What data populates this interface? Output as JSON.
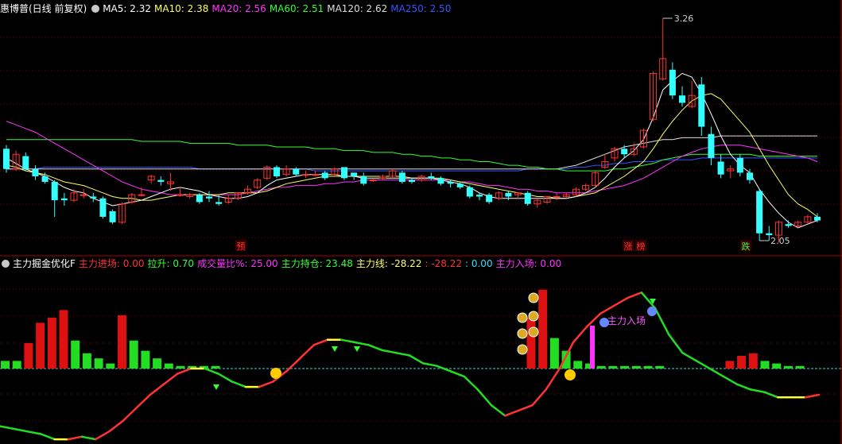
{
  "main_header": {
    "stock_title": "惠博普(日线 前复权)",
    "mas": [
      {
        "label": "MA5: 2.32",
        "color": "#ffffff"
      },
      {
        "label": "MA10: 2.38",
        "color": "#ffff66"
      },
      {
        "label": "MA20: 2.56",
        "color": "#ff33ff"
      },
      {
        "label": "MA60: 2.51",
        "color": "#33ff33"
      },
      {
        "label": "MA120: 2.62",
        "color": "#dddddd"
      },
      {
        "label": "MA250: 2.50",
        "color": "#3355ff"
      }
    ]
  },
  "price_labels": {
    "high": "3.26",
    "low": "2.05"
  },
  "markers": [
    {
      "text": "预",
      "color": "#ff3333"
    },
    {
      "text": "涨",
      "color": "#ff3333"
    },
    {
      "text": "榜",
      "color": "#ff3333"
    },
    {
      "text": "跌",
      "color": "#33ff33"
    }
  ],
  "indicator_header": {
    "title": "主力掘金优化F",
    "items": [
      {
        "label": "主力进场: 0.00",
        "color": "#ff3333"
      },
      {
        "label": "拉升: 0.70",
        "color": "#33ff33"
      },
      {
        "label": "成交量比%: 25.00",
        "color": "#ff33ff"
      },
      {
        "label": "主力持仓: 23.48",
        "color": "#33ff33"
      },
      {
        "label": "主力线: -28.22",
        "color": "#ffff66"
      },
      {
        "label": ": -28.22",
        "color": "#ff3333"
      },
      {
        "label": ": 0.00",
        "color": "#33ddff"
      },
      {
        "label": "主力入场: 0.00",
        "color": "#ff33ff"
      }
    ]
  },
  "annotation": {
    "zhuli_ruchang": "主力入场"
  },
  "colors": {
    "up": "#ff3333",
    "down": "#33ffff",
    "grid": "#7a0000",
    "bar_red": "#dd1111",
    "bar_green": "#22dd22"
  },
  "candles": [
    [
      2.55,
      2.44,
      2.57,
      2.42
    ],
    [
      2.44,
      2.52,
      2.54,
      2.43
    ],
    [
      2.51,
      2.44,
      2.53,
      2.43
    ],
    [
      2.44,
      2.4,
      2.46,
      2.38
    ],
    [
      2.4,
      2.37,
      2.42,
      2.36
    ],
    [
      2.37,
      2.27,
      2.38,
      2.18
    ],
    [
      2.28,
      2.27,
      2.31,
      2.24
    ],
    [
      2.27,
      2.31,
      2.33,
      2.26
    ],
    [
      2.3,
      2.3,
      2.33,
      2.28
    ],
    [
      2.29,
      2.28,
      2.31,
      2.26
    ],
    [
      2.28,
      2.18,
      2.29,
      2.17
    ],
    [
      2.21,
      2.15,
      2.22,
      2.14
    ],
    [
      2.15,
      2.25,
      2.26,
      2.14
    ],
    [
      2.26,
      2.3,
      2.31,
      2.25
    ],
    [
      2.3,
      2.3,
      2.34,
      2.29
    ],
    [
      2.38,
      2.4,
      2.41,
      2.36
    ],
    [
      2.38,
      2.37,
      2.4,
      2.35
    ],
    [
      2.36,
      2.37,
      2.42,
      2.32
    ],
    [
      2.3,
      2.3,
      2.34,
      2.29
    ],
    [
      2.29,
      2.3,
      2.31,
      2.28
    ],
    [
      2.3,
      2.26,
      2.31,
      2.25
    ],
    [
      2.29,
      2.28,
      2.32,
      2.26
    ],
    [
      2.26,
      2.25,
      2.3,
      2.24
    ],
    [
      2.26,
      2.28,
      2.3,
      2.25
    ],
    [
      2.28,
      2.31,
      2.31,
      2.27
    ],
    [
      2.31,
      2.33,
      2.35,
      2.3
    ],
    [
      2.34,
      2.38,
      2.39,
      2.33
    ],
    [
      2.39,
      2.45,
      2.46,
      2.38
    ],
    [
      2.45,
      2.4,
      2.46,
      2.39
    ],
    [
      2.41,
      2.44,
      2.46,
      2.4
    ],
    [
      2.44,
      2.41,
      2.45,
      2.4
    ],
    [
      2.41,
      2.41,
      2.43,
      2.39
    ],
    [
      2.41,
      2.41,
      2.43,
      2.4
    ],
    [
      2.42,
      2.39,
      2.43,
      2.38
    ],
    [
      2.41,
      2.44,
      2.45,
      2.4
    ],
    [
      2.45,
      2.39,
      2.45,
      2.38
    ],
    [
      2.42,
      2.4,
      2.42,
      2.38
    ],
    [
      2.4,
      2.36,
      2.42,
      2.35
    ],
    [
      2.38,
      2.38,
      2.39,
      2.37
    ],
    [
      2.39,
      2.4,
      2.41,
      2.38
    ],
    [
      2.4,
      2.43,
      2.44,
      2.39
    ],
    [
      2.42,
      2.37,
      2.43,
      2.36
    ],
    [
      2.38,
      2.37,
      2.39,
      2.36
    ],
    [
      2.38,
      2.4,
      2.41,
      2.37
    ],
    [
      2.4,
      2.39,
      2.42,
      2.38
    ],
    [
      2.39,
      2.36,
      2.4,
      2.35
    ],
    [
      2.37,
      2.36,
      2.38,
      2.34
    ],
    [
      2.36,
      2.34,
      2.37,
      2.33
    ],
    [
      2.34,
      2.29,
      2.35,
      2.28
    ],
    [
      2.3,
      2.29,
      2.31,
      2.27
    ],
    [
      2.3,
      2.26,
      2.31,
      2.25
    ],
    [
      2.28,
      2.31,
      2.32,
      2.27
    ],
    [
      2.31,
      2.29,
      2.32,
      2.27
    ],
    [
      2.3,
      2.31,
      2.31,
      2.28
    ],
    [
      2.31,
      2.25,
      2.32,
      2.24
    ],
    [
      2.25,
      2.27,
      2.28,
      2.23
    ],
    [
      2.26,
      2.29,
      2.29,
      2.25
    ],
    [
      2.29,
      2.29,
      2.31,
      2.27
    ],
    [
      2.29,
      2.3,
      2.31,
      2.28
    ],
    [
      2.3,
      2.33,
      2.34,
      2.29
    ],
    [
      2.33,
      2.35,
      2.36,
      2.32
    ],
    [
      2.35,
      2.42,
      2.43,
      2.34
    ],
    [
      2.45,
      2.48,
      2.52,
      2.44
    ],
    [
      2.5,
      2.55,
      2.56,
      2.48
    ],
    [
      2.55,
      2.52,
      2.57,
      2.5
    ],
    [
      2.52,
      2.55,
      2.58,
      2.51
    ],
    [
      2.56,
      2.65,
      2.66,
      2.55
    ],
    [
      2.71,
      2.96,
      2.97,
      2.7
    ],
    [
      2.93,
      3.04,
      3.26,
      2.92
    ],
    [
      2.98,
      2.84,
      3.02,
      2.82
    ],
    [
      2.84,
      2.8,
      2.89,
      2.78
    ],
    [
      2.78,
      2.84,
      2.92,
      2.77
    ],
    [
      2.9,
      2.67,
      2.94,
      2.62
    ],
    [
      2.63,
      2.5,
      2.67,
      2.46
    ],
    [
      2.48,
      2.41,
      2.52,
      2.39
    ],
    [
      2.43,
      2.44,
      2.46,
      2.39
    ],
    [
      2.5,
      2.42,
      2.52,
      2.4
    ],
    [
      2.42,
      2.38,
      2.44,
      2.36
    ],
    [
      2.32,
      2.09,
      2.33,
      2.05
    ],
    [
      2.09,
      2.08,
      2.13,
      2.05
    ],
    [
      2.08,
      2.15,
      2.16,
      2.04
    ],
    [
      2.14,
      2.13,
      2.16,
      2.12
    ],
    [
      2.13,
      2.15,
      2.16,
      2.12
    ],
    [
      2.15,
      2.18,
      2.19,
      2.14
    ],
    [
      2.18,
      2.16,
      2.2,
      2.15
    ]
  ],
  "ma5": [
    2.5,
    2.47,
    2.44,
    2.42,
    2.4,
    2.37,
    2.34,
    2.32,
    2.31,
    2.28,
    2.26,
    2.24,
    2.25,
    2.26,
    2.27,
    2.29,
    2.31,
    2.33,
    2.34,
    2.33,
    2.32,
    2.3,
    2.29,
    2.28,
    2.28,
    2.29,
    2.31,
    2.35,
    2.38,
    2.39,
    2.4,
    2.41,
    2.41,
    2.41,
    2.41,
    2.4,
    2.4,
    2.39,
    2.39,
    2.39,
    2.39,
    2.39,
    2.39,
    2.39,
    2.39,
    2.38,
    2.37,
    2.36,
    2.34,
    2.31,
    2.29,
    2.28,
    2.28,
    2.28,
    2.28,
    2.28,
    2.28,
    2.28,
    2.28,
    2.29,
    2.31,
    2.34,
    2.39,
    2.45,
    2.5,
    2.54,
    2.6,
    2.72,
    2.87,
    2.92,
    2.96,
    2.94,
    2.85,
    2.74,
    2.62,
    2.52,
    2.46,
    2.42,
    2.33,
    2.26,
    2.2,
    2.15,
    2.12,
    2.14,
    2.16
  ],
  "ma10": [
    2.46,
    2.45,
    2.43,
    2.42,
    2.41,
    2.39,
    2.37,
    2.36,
    2.35,
    2.33,
    2.31,
    2.29,
    2.28,
    2.28,
    2.27,
    2.27,
    2.28,
    2.29,
    2.3,
    2.3,
    2.3,
    2.3,
    2.3,
    2.31,
    2.31,
    2.31,
    2.31,
    2.32,
    2.34,
    2.36,
    2.37,
    2.38,
    2.39,
    2.4,
    2.4,
    2.4,
    2.4,
    2.4,
    2.4,
    2.4,
    2.4,
    2.4,
    2.39,
    2.39,
    2.39,
    2.39,
    2.38,
    2.37,
    2.36,
    2.35,
    2.34,
    2.33,
    2.32,
    2.31,
    2.3,
    2.29,
    2.29,
    2.28,
    2.28,
    2.29,
    2.3,
    2.31,
    2.34,
    2.37,
    2.4,
    2.44,
    2.48,
    2.55,
    2.63,
    2.7,
    2.76,
    2.81,
    2.84,
    2.85,
    2.82,
    2.76,
    2.7,
    2.64,
    2.55,
    2.46,
    2.38,
    2.3,
    2.25,
    2.22,
    2.18
  ],
  "ma20": [
    2.7,
    2.68,
    2.66,
    2.64,
    2.61,
    2.58,
    2.55,
    2.52,
    2.49,
    2.46,
    2.43,
    2.4,
    2.37,
    2.35,
    2.33,
    2.32,
    2.31,
    2.3,
    2.3,
    2.3,
    2.3,
    2.3,
    2.3,
    2.3,
    2.3,
    2.31,
    2.32,
    2.33,
    2.34,
    2.34,
    2.35,
    2.35,
    2.35,
    2.36,
    2.36,
    2.37,
    2.37,
    2.38,
    2.38,
    2.38,
    2.38,
    2.38,
    2.38,
    2.38,
    2.38,
    2.38,
    2.38,
    2.37,
    2.37,
    2.36,
    2.35,
    2.35,
    2.34,
    2.33,
    2.33,
    2.32,
    2.32,
    2.31,
    2.31,
    2.31,
    2.31,
    2.32,
    2.33,
    2.34,
    2.35,
    2.37,
    2.39,
    2.42,
    2.45,
    2.48,
    2.51,
    2.53,
    2.55,
    2.56,
    2.57,
    2.57,
    2.57,
    2.56,
    2.55,
    2.54,
    2.53,
    2.52,
    2.51,
    2.5,
    2.48
  ],
  "ma60": [
    2.6,
    2.6,
    2.6,
    2.6,
    2.6,
    2.6,
    2.6,
    2.6,
    2.6,
    2.6,
    2.6,
    2.6,
    2.6,
    2.6,
    2.59,
    2.59,
    2.59,
    2.59,
    2.59,
    2.58,
    2.58,
    2.58,
    2.58,
    2.58,
    2.57,
    2.57,
    2.57,
    2.57,
    2.56,
    2.56,
    2.56,
    2.56,
    2.55,
    2.55,
    2.55,
    2.54,
    2.54,
    2.54,
    2.53,
    2.53,
    2.53,
    2.52,
    2.52,
    2.51,
    2.51,
    2.5,
    2.5,
    2.49,
    2.49,
    2.48,
    2.48,
    2.47,
    2.46,
    2.46,
    2.45,
    2.45,
    2.44,
    2.44,
    2.43,
    2.43,
    2.43,
    2.43,
    2.43,
    2.44,
    2.44,
    2.45,
    2.46,
    2.47,
    2.49,
    2.5,
    2.51,
    2.52,
    2.52,
    2.52,
    2.52,
    2.52,
    2.52,
    2.52,
    2.51,
    2.51,
    2.51,
    2.51,
    2.51,
    2.51,
    2.51
  ],
  "ma120": [
    2.44,
    2.44,
    2.44,
    2.44,
    2.44,
    2.44,
    2.44,
    2.44,
    2.44,
    2.44,
    2.44,
    2.44,
    2.44,
    2.44,
    2.44,
    2.44,
    2.44,
    2.44,
    2.44,
    2.44,
    2.44,
    2.44,
    2.44,
    2.44,
    2.44,
    2.44,
    2.44,
    2.44,
    2.44,
    2.44,
    2.44,
    2.44,
    2.44,
    2.44,
    2.44,
    2.44,
    2.44,
    2.44,
    2.44,
    2.44,
    2.44,
    2.44,
    2.44,
    2.44,
    2.44,
    2.44,
    2.44,
    2.44,
    2.44,
    2.44,
    2.44,
    2.44,
    2.44,
    2.44,
    2.44,
    2.44,
    2.44,
    2.44,
    2.45,
    2.46,
    2.48,
    2.5,
    2.52,
    2.54,
    2.56,
    2.57,
    2.58,
    2.59,
    2.6,
    2.6,
    2.61,
    2.61,
    2.61,
    2.61,
    2.62,
    2.62,
    2.62,
    2.62,
    2.62,
    2.62,
    2.62,
    2.62,
    2.62,
    2.62,
    2.62
  ],
  "ma250": [
    2.44,
    2.44,
    2.44,
    2.44,
    2.45,
    2.45,
    2.45,
    2.45,
    2.45,
    2.45,
    2.45,
    2.45,
    2.45,
    2.45,
    2.45,
    2.45,
    2.45,
    2.45,
    2.45,
    2.45,
    2.44,
    2.44,
    2.44,
    2.44,
    2.44,
    2.44,
    2.44,
    2.44,
    2.44,
    2.44,
    2.44,
    2.44,
    2.43,
    2.43,
    2.43,
    2.43,
    2.43,
    2.43,
    2.43,
    2.43,
    2.43,
    2.43,
    2.43,
    2.43,
    2.43,
    2.43,
    2.43,
    2.43,
    2.43,
    2.43,
    2.43,
    2.43,
    2.43,
    2.43,
    2.44,
    2.44,
    2.44,
    2.44,
    2.44,
    2.45,
    2.45,
    2.46,
    2.46,
    2.47,
    2.47,
    2.48,
    2.48,
    2.48,
    2.49,
    2.49,
    2.49,
    2.49,
    2.5,
    2.5,
    2.5,
    2.5,
    2.5,
    2.5,
    2.5,
    2.5,
    2.5,
    2.5,
    2.5,
    2.5,
    2.5
  ],
  "ind_bars": [
    [
      0,
      3
    ],
    [
      0,
      3
    ],
    [
      1,
      10
    ],
    [
      1,
      18
    ],
    [
      1,
      20
    ],
    [
      1,
      23
    ],
    [
      0,
      11
    ],
    [
      0,
      6
    ],
    [
      0,
      4
    ],
    [
      0,
      2
    ],
    [
      1,
      21
    ],
    [
      0,
      11
    ],
    [
      0,
      7
    ],
    [
      0,
      4
    ],
    [
      0,
      2
    ],
    [
      0,
      1
    ],
    [
      0,
      1
    ],
    [
      0,
      1
    ],
    [
      0,
      1
    ],
    [
      0,
      0
    ],
    [
      0,
      0
    ],
    [
      0,
      0
    ],
    [
      0,
      0
    ],
    [
      0,
      0
    ],
    [
      0,
      0
    ],
    [
      0,
      0
    ],
    [
      0,
      0
    ],
    [
      0,
      0
    ],
    [
      0,
      0
    ],
    [
      0,
      0
    ],
    [
      0,
      0
    ],
    [
      0,
      0
    ],
    [
      0,
      0
    ],
    [
      0,
      0
    ],
    [
      0,
      0
    ],
    [
      0,
      0
    ],
    [
      0,
      0
    ],
    [
      0,
      0
    ],
    [
      0,
      0
    ],
    [
      0,
      0
    ],
    [
      0,
      0
    ],
    [
      0,
      0
    ],
    [
      0,
      0
    ],
    [
      0,
      0
    ],
    [
      0,
      0
    ],
    [
      1,
      20
    ],
    [
      1,
      31
    ],
    [
      0,
      12
    ],
    [
      0,
      7
    ],
    [
      0,
      3
    ],
    [
      0,
      2
    ],
    [
      0,
      1
    ],
    [
      0,
      1
    ],
    [
      0,
      1
    ],
    [
      0,
      1
    ],
    [
      0,
      1
    ],
    [
      0,
      1
    ],
    [
      0,
      0
    ],
    [
      0,
      0
    ],
    [
      0,
      0
    ],
    [
      0,
      0
    ],
    [
      0,
      0
    ],
    [
      1,
      3
    ],
    [
      1,
      5
    ],
    [
      1,
      6
    ],
    [
      0,
      3
    ],
    [
      0,
      2
    ],
    [
      0,
      1
    ],
    [
      0,
      1
    ]
  ],
  "ind_line": [
    -22,
    -23,
    -24,
    -25,
    -27,
    -27,
    -26,
    -27,
    -24,
    -20,
    -15,
    -10,
    -6,
    -2,
    0,
    0,
    -2,
    -5,
    -7,
    -7,
    -5,
    -1,
    4,
    9,
    11,
    11,
    10,
    9,
    7,
    6,
    5,
    2,
    1,
    -1,
    -3,
    -8,
    -14,
    -18,
    -16,
    -14,
    -8,
    0,
    10,
    16,
    21,
    24,
    27,
    29,
    23,
    13,
    6,
    3,
    0,
    -3,
    -6,
    -8,
    -9,
    -11,
    -11,
    -11,
    -10
  ]
}
